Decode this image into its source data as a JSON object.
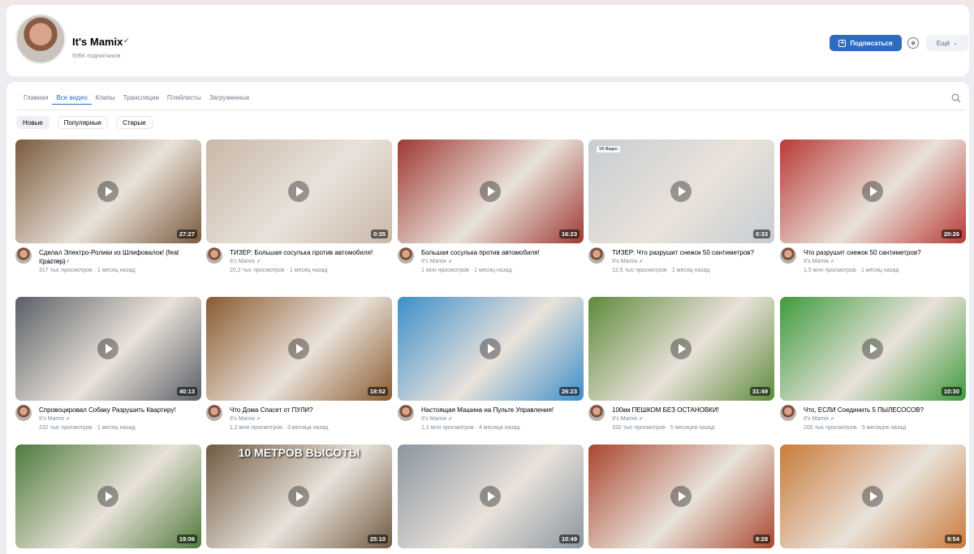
{
  "channel": {
    "name": "It's Mamix",
    "subscribers": "506K подписчиков",
    "subscribe_label": "Подписаться",
    "more_label": "Ещё",
    "verified_icon": "verified-check-icon"
  },
  "tabs": [
    {
      "label": "Главная"
    },
    {
      "label": "Все видео",
      "active": true
    },
    {
      "label": "Клипы"
    },
    {
      "label": "Трансляции"
    },
    {
      "label": "Плейлисты"
    },
    {
      "label": "Загруженные"
    }
  ],
  "filters": [
    {
      "label": "Новые",
      "active": true
    },
    {
      "label": "Популярные"
    },
    {
      "label": "Старые"
    }
  ],
  "videos": [
    {
      "title": "Сделал Электро-Ролики из Шлифовалок! (feat Крастер)",
      "author": "It's Mamix",
      "views": "317 тыс просмотров",
      "age": "1 месяц назад",
      "duration": "27:27",
      "color": "#7a5a3c"
    },
    {
      "title": "ТИЗЕР: Большая сосулька против автомобиля!",
      "author": "It's Mamix",
      "views": "20,2 тыс просмотров",
      "age": "1 месяц назад",
      "duration": "0:35",
      "color": "#c9b8a8",
      "badge": ""
    },
    {
      "title": "Большая сосулька против автомобиля!",
      "author": "It's Mamix",
      "views": "1 млн просмотров",
      "age": "1 месяц назад",
      "duration": "16:23",
      "color": "#9e3a33"
    },
    {
      "title": "ТИЗЕР: Что разрушит снежок 50 сантиметров?",
      "author": "It's Mamix",
      "views": "12,5 тыс просмотров",
      "age": "1 месяц назад",
      "duration": "0:33",
      "color": "#c7cdd3",
      "badge": "VK Видео"
    },
    {
      "title": "Что разрушит снежок 50 сантиметров?",
      "author": "It's Mamix",
      "views": "1,5 млн просмотров",
      "age": "1 месяц назад",
      "duration": "20:26",
      "color": "#b83a35"
    },
    {
      "title": "Спровоцировал Собаку Разрушить Квартиру!",
      "author": "It's Mamix",
      "views": "232 тыс просмотров",
      "age": "1 месяц назад",
      "duration": "40:13",
      "color": "#5a5f66"
    },
    {
      "title": "Что Дома Спасет от ПУЛИ?",
      "author": "It's Mamix",
      "views": "1,2 млн просмотров",
      "age": "3 месяца назад",
      "duration": "18:52",
      "color": "#8a5a2e"
    },
    {
      "title": "Настоящая Машина на Пульте Управления!",
      "author": "It's Mamix",
      "views": "1,1 млн просмотров",
      "age": "4 месяца назад",
      "duration": "26:23",
      "color": "#3b8fc9"
    },
    {
      "title": "100км ПЕШКОМ БЕЗ ОСТАНОВКИ!",
      "author": "It's Mamix",
      "views": "332 тыс просмотров",
      "age": "5 месяцев назад",
      "duration": "31:49",
      "color": "#5e8a3a"
    },
    {
      "title": "Что, ЕСЛИ Соединить 5 ПЫЛЕСОСОВ?",
      "author": "It's Mamix",
      "views": "200 тыс просмотров",
      "age": "5 месяцев назад",
      "duration": "10:30",
      "color": "#3f9a3c"
    },
    {
      "title": "",
      "author": "",
      "views": "",
      "age": "",
      "duration": "19:06",
      "color": "#4e7a3a"
    },
    {
      "title": "",
      "author": "",
      "views": "",
      "age": "",
      "duration": "25:10",
      "color": "#6f5a42",
      "banner": "10 МЕТРОВ ВЫСОТЫ"
    },
    {
      "title": "",
      "author": "",
      "views": "",
      "age": "",
      "duration": "10:49",
      "color": "#8a96a0"
    },
    {
      "title": "",
      "author": "",
      "views": "",
      "age": "",
      "duration": "9:28",
      "color": "#a8472e"
    },
    {
      "title": "",
      "author": "",
      "views": "",
      "age": "",
      "duration": "9:54",
      "color": "#c97a3a"
    }
  ]
}
